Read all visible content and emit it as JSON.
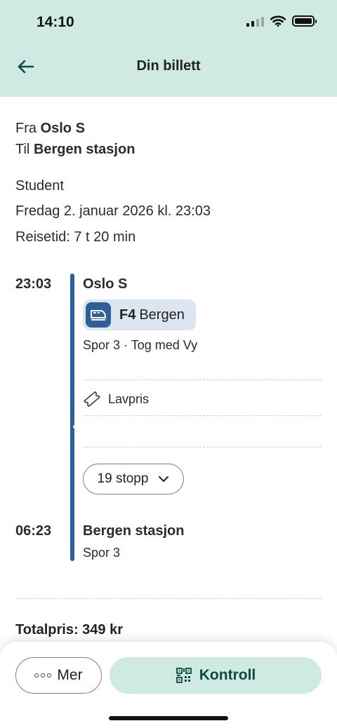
{
  "status": {
    "time": "14:10"
  },
  "header": {
    "title": "Din billett"
  },
  "trip": {
    "from_label": "Fra",
    "from": "Oslo S",
    "to_label": "Til",
    "to": "Bergen stasjon",
    "traveler": "Student",
    "departure_text": "Fredag 2. januar 2026 kl. 23:03",
    "duration_text": "Reisetid: 7 t 20 min"
  },
  "timeline": {
    "departure_time": "23:03",
    "departure_station": "Oslo S",
    "line_code": "F4",
    "line_destination": "Bergen",
    "departure_details": "Spor 3 · Tog med Vy",
    "fare_type": "Lavpris",
    "stops_label": "19 stopp",
    "arrival_time": "06:23",
    "arrival_station": "Bergen stasjon",
    "arrival_track": "Spor 3"
  },
  "total": {
    "label": "Totalpris: 349 kr"
  },
  "actions": {
    "more_label": "Mer",
    "control_label": "Kontroll"
  },
  "colors": {
    "header_bg": "#cfeae3",
    "timeline": "#2f5f99",
    "chip_bg": "#dde5f0",
    "control_text": "#0b4a40"
  },
  "icons": [
    "back-arrow-icon",
    "train-icon",
    "ticket-icon",
    "chevron-down-icon",
    "more-dots-icon",
    "qr-code-icon"
  ]
}
